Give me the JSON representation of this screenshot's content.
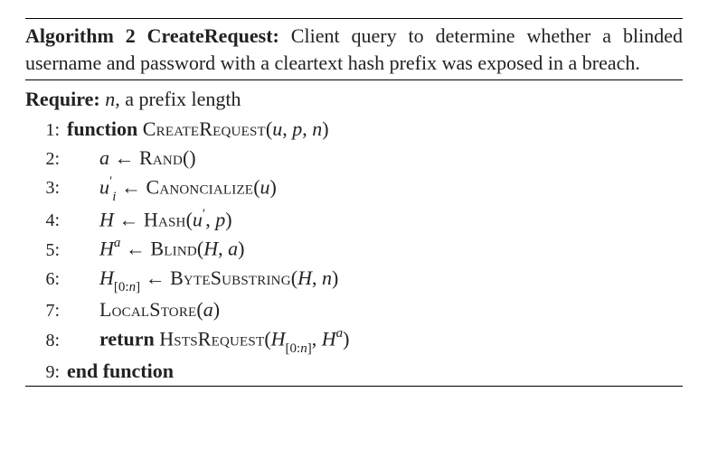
{
  "header": {
    "title_bold": "Algorithm 2 CreateRequest:",
    "title_rest": " Client query to determine whether a blinded username and password with a cleartext hash prefix was exposed in a breach."
  },
  "require": {
    "label": "Require:",
    "var": "n",
    "desc": ", a prefix length"
  },
  "lines": {
    "l1": {
      "no": "1:",
      "kw": "function",
      "fn": "CreateRequest",
      "args_u": "u",
      "args_p": "p",
      "args_n": "n"
    },
    "l2": {
      "no": "2:",
      "lhs": "a",
      "arrow": " ← ",
      "fn": "Rand",
      "args": "()"
    },
    "l3": {
      "no": "3:",
      "lhs_u": "u",
      "lhs_prime": "′",
      "lhs_sub": "i",
      "arrow": " ← ",
      "fn": "Canoncialize",
      "arg_u": "u"
    },
    "l4": {
      "no": "4:",
      "lhs": "H",
      "arrow": " ← ",
      "fn": "Hash",
      "arg_u": "u",
      "arg_prime": "′",
      "arg_p": "p"
    },
    "l5": {
      "no": "5:",
      "lhs_H": "H",
      "lhs_sup": "a",
      "arrow": " ← ",
      "fn": "Blind",
      "arg_H": "H",
      "arg_a": "a"
    },
    "l6": {
      "no": "6:",
      "lhs_H": "H",
      "lhs_sub": "[0:",
      "lhs_sub_n": "n",
      "lhs_sub_end": "]",
      "arrow": " ← ",
      "fn": "ByteSubstring",
      "arg_H": "H",
      "arg_n": "n"
    },
    "l7": {
      "no": "7:",
      "fn": "LocalStore",
      "arg_a": "a"
    },
    "l8": {
      "no": "8:",
      "kw": "return",
      "fn": "HstsRequest",
      "arg_H": "H",
      "arg_sub": "[0:",
      "arg_sub_n": "n",
      "arg_sub_end": "]",
      "arg_H2": "H",
      "arg_sup": "a"
    },
    "l9": {
      "no": "9:",
      "kw": "end function"
    }
  }
}
